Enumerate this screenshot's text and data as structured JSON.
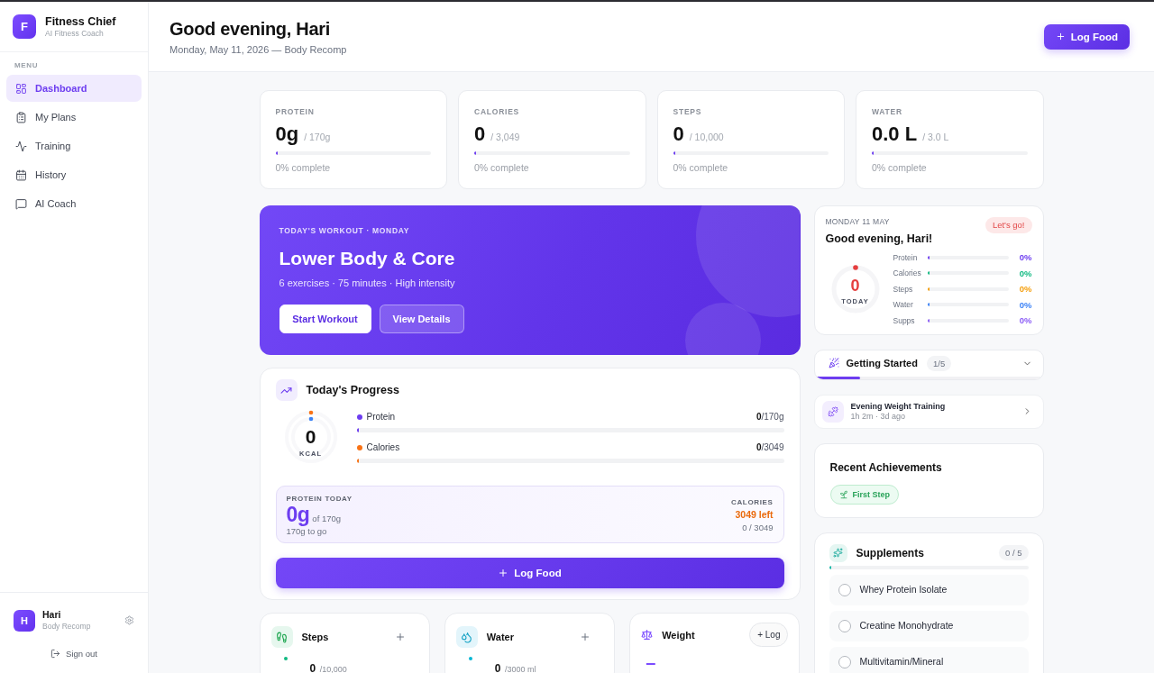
{
  "sidebar": {
    "brand": {
      "initial": "F",
      "name": "Fitness Chief",
      "tagline": "AI Fitness Coach"
    },
    "menu_label": "MENU",
    "items": [
      {
        "label": "Dashboard",
        "selected": true
      },
      {
        "label": "My Plans",
        "selected": false
      },
      {
        "label": "Training",
        "selected": false
      },
      {
        "label": "History",
        "selected": false
      },
      {
        "label": "AI Coach",
        "selected": false
      }
    ],
    "user": {
      "initial": "H",
      "name": "Hari",
      "plan": "Body Recomp"
    },
    "sign_out": "Sign out"
  },
  "header": {
    "title": "Good evening, Hari",
    "subtitle": "Monday, May 11, 2026 — Body Recomp",
    "action": "Log Food"
  },
  "stats": [
    {
      "label": "PROTEIN",
      "value": "0g",
      "target": "/ 170g",
      "level": 0,
      "caption": "0% complete"
    },
    {
      "label": "CALORIES",
      "value": "0",
      "target": "/ 3,049",
      "level": 0,
      "caption": "0% complete"
    },
    {
      "label": "STEPS",
      "value": "0",
      "target": "/ 10,000",
      "level": 0,
      "caption": "0% complete"
    },
    {
      "label": "WATER",
      "value": "0.0 L",
      "target": "/ 3.0 L",
      "level": 0,
      "caption": "0% complete"
    }
  ],
  "workout": {
    "eyebrow": "TODAY'S WORKOUT · MONDAY",
    "title": "Lower Body & Core",
    "details": "6 exercises · 75 minutes · High intensity",
    "buttons": [
      {
        "label": "Start Workout",
        "kind": "primary"
      },
      {
        "label": "View Details",
        "kind": "secondary"
      }
    ]
  },
  "progress": {
    "title": "Today's Progress",
    "rings": [
      {
        "color": "#f97316"
      },
      {
        "color": "#3b82f6"
      }
    ],
    "total": "0",
    "unit": "KCAL",
    "macros": [
      {
        "label": "Protein",
        "color": "#6d3df0",
        "amount": "**0**/170g",
        "level": 0
      },
      {
        "label": "Calories",
        "color": "#f97316",
        "amount": "**0**/3049",
        "level": 0
      }
    ],
    "summary": {
      "label": "PROTEIN TODAY",
      "value": "0g",
      "of": "of 170g",
      "remaining": "170g to go",
      "calories_label": "CALORIES",
      "calories_left": "3049 left",
      "calories_total": "0 / 3049"
    },
    "action": "Log Food"
  },
  "trackers": [
    {
      "kind": "steps",
      "title": "Steps",
      "color": "#10b981",
      "value": "0",
      "target": "/10,000"
    },
    {
      "kind": "water",
      "title": "Water",
      "color": "#06b6d4",
      "value": "0",
      "target": "/3000 ml"
    },
    {
      "kind": "weight",
      "title": "Weight",
      "action": "+ Log",
      "value": "–"
    }
  ],
  "today": {
    "date": "MONDAY 11 MAY",
    "badge": "Let's go!",
    "greeting": "Good evening, Hari!",
    "total": "0",
    "total_label": "TODAY",
    "rows": [
      {
        "label": "Protein",
        "percent": "0%",
        "color": "#6d3df0",
        "level": 0
      },
      {
        "label": "Calories",
        "percent": "0%",
        "color": "#10b981",
        "level": 0
      },
      {
        "label": "Steps",
        "percent": "0%",
        "color": "#f59e0b",
        "level": 0
      },
      {
        "label": "Water",
        "percent": "0%",
        "color": "#3b82f6",
        "level": 0
      },
      {
        "label": "Supps",
        "percent": "0%",
        "color": "#8b5cf6",
        "level": 0
      }
    ]
  },
  "getting_started": {
    "title": "Getting Started",
    "count": "1/5",
    "expanded": false,
    "level": 0.2
  },
  "recent_session": {
    "title": "Evening Weight Training",
    "meta": "1h 2m · 3d ago"
  },
  "achievements": {
    "title": "Recent Achievements",
    "badges": [
      {
        "label": "First Step"
      }
    ]
  },
  "supplements": {
    "title": "Supplements",
    "count": "0 / 5",
    "level": 0,
    "items": [
      {
        "label": "Whey Protein Isolate",
        "checked": false
      },
      {
        "label": "Creatine Monohydrate",
        "checked": false
      },
      {
        "label": "Multivitamin/Mineral",
        "checked": false
      }
    ]
  }
}
